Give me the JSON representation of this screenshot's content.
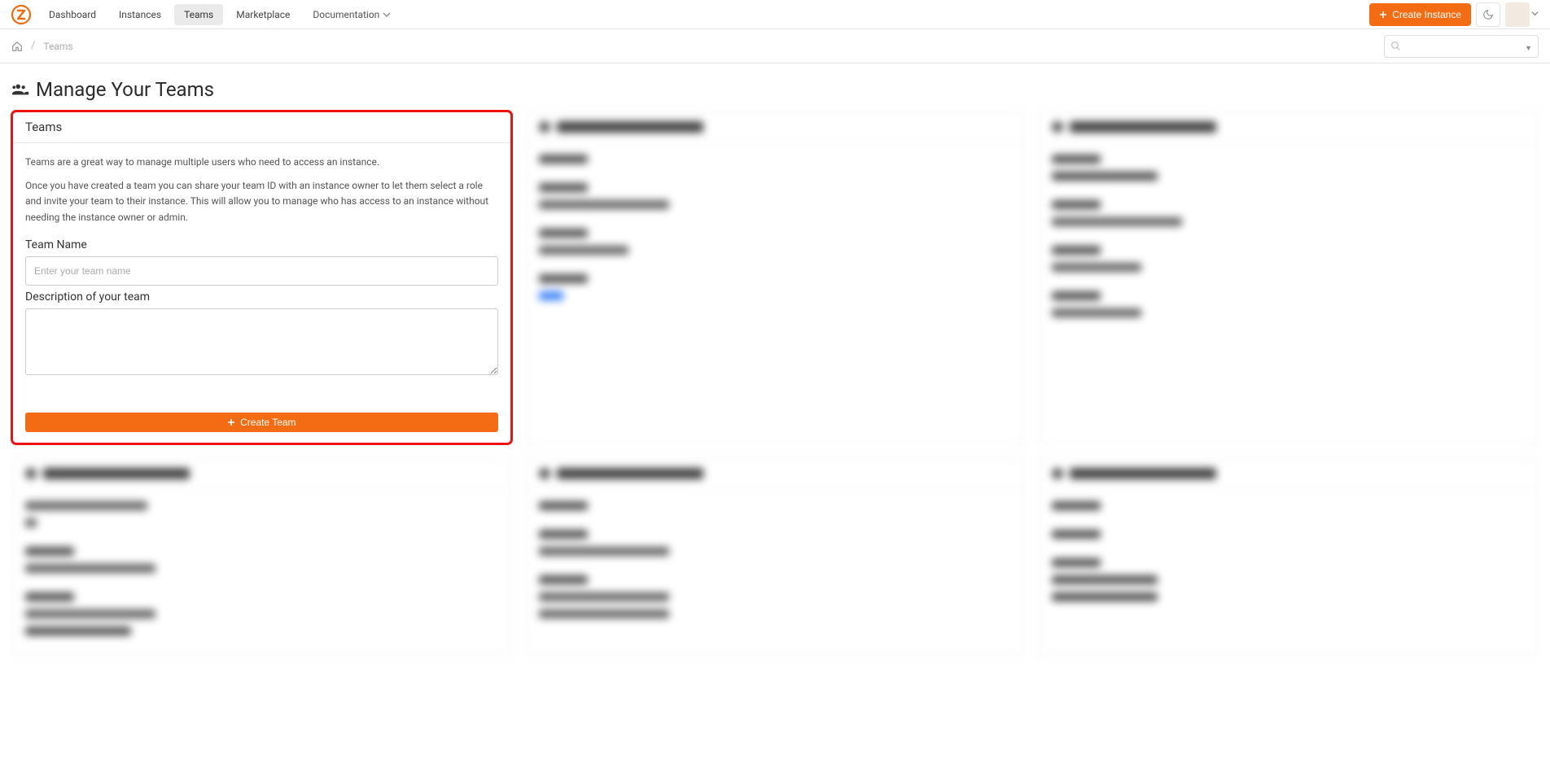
{
  "nav": {
    "items": [
      "Dashboard",
      "Instances",
      "Teams",
      "Marketplace"
    ],
    "documentation": "Documentation",
    "create_instance": "Create Instance"
  },
  "breadcrumb": {
    "current": "Teams"
  },
  "page": {
    "title": "Manage Your Teams"
  },
  "teams_card": {
    "header": "Teams",
    "intro": "Teams are a great way to manage multiple users who need to access an instance.",
    "detail": "Once you have created a team you can share your team ID with an instance owner to let them select a role and invite your team to their instance. This will allow you to manage who has access to an instance without needing the instance owner or admin.",
    "name_label": "Team Name",
    "name_placeholder": "Enter your team name",
    "desc_label": "Description of your team",
    "create_btn": "Create Team"
  }
}
